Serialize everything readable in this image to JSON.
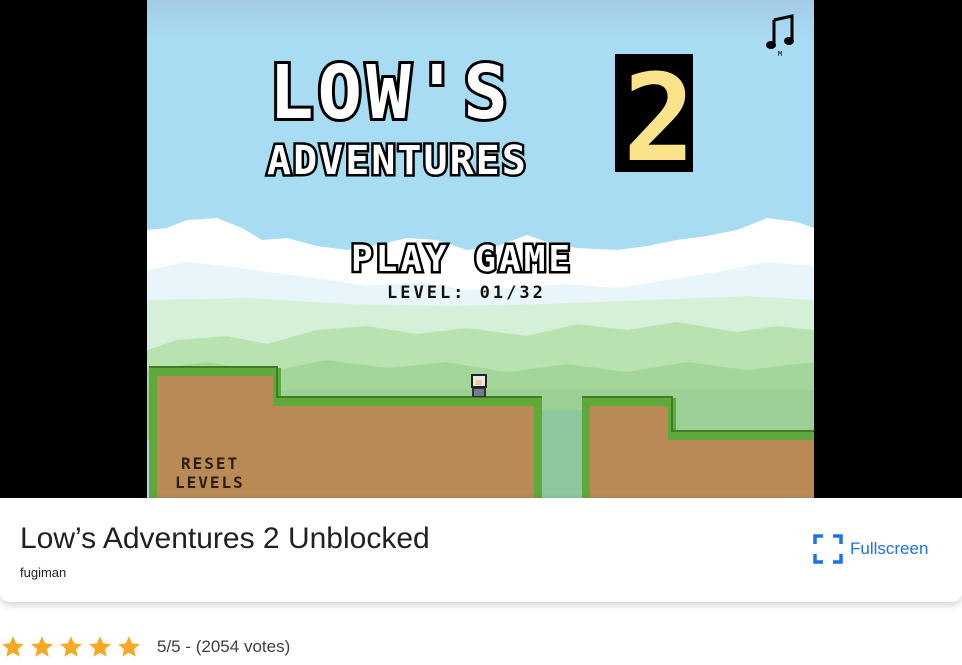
{
  "game": {
    "logo_line1": "LOW'S",
    "logo_line2": "ADVENTURES",
    "logo_number": "2",
    "play_label": "PLAY GAME",
    "level_text": "LEVEL: 01/32",
    "reset_line1": "RESET",
    "reset_line2": "LEVELS",
    "music_key": "M",
    "icons": {
      "music": "music-note-icon"
    }
  },
  "info": {
    "title": "Low’s Adventures 2 Unblocked",
    "author": "fugiman",
    "fullscreen_label": "Fullscreen",
    "icons": {
      "fullscreen": "fullscreen-icon"
    }
  },
  "rating": {
    "stars": 5,
    "text": "5/5 - (2054 votes)",
    "star_color": "#f9a825"
  },
  "colors": {
    "sky": "#a6dcf2",
    "accent_blue": "#1a73e8",
    "logo_yellow": "#fbe38c",
    "grass": "#5fa83a",
    "dirt": "#b98a55"
  }
}
